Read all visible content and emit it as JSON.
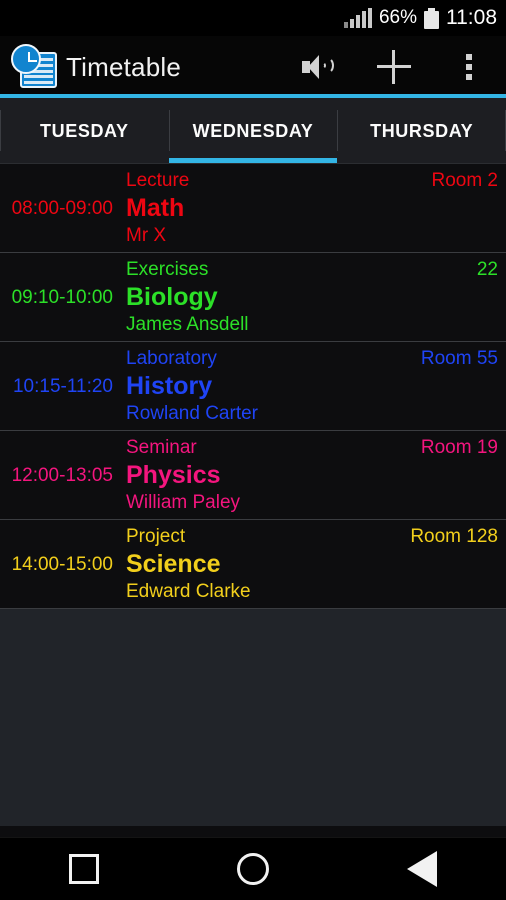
{
  "statusbar": {
    "signal_icon": "signal-bars-icon",
    "battery_percent": "66%",
    "battery_icon": "battery-icon",
    "time": "11:08"
  },
  "actionbar": {
    "app_icon": "timetable-app-icon",
    "title": "Timetable",
    "actions": [
      {
        "name": "volume-icon",
        "label": ""
      },
      {
        "name": "add-icon",
        "label": ""
      },
      {
        "name": "overflow-menu-icon",
        "label": ""
      }
    ],
    "accent_color": "#33b5e5"
  },
  "tabs": {
    "active_index": 1,
    "items": [
      {
        "label": "TUESDAY"
      },
      {
        "label": "WEDNESDAY"
      },
      {
        "label": "THURSDAY"
      }
    ]
  },
  "lessons": [
    {
      "time": "08:00-09:00",
      "type": "Lecture",
      "subject": "Math",
      "teacher": "Mr X",
      "room": "Room 2",
      "color": "#ee0612"
    },
    {
      "time": "09:10-10:00",
      "type": "Exercises",
      "subject": "Biology",
      "teacher": "James Ansdell",
      "room": "22",
      "color": "#2ce028"
    },
    {
      "time": "10:15-11:20",
      "type": "Laboratory",
      "subject": "History",
      "teacher": "Rowland Carter",
      "room": "Room 55",
      "color": "#1f44f5"
    },
    {
      "time": "12:00-13:05",
      "type": "Seminar",
      "subject": "Physics",
      "teacher": "William Paley",
      "room": "Room 19",
      "color": "#f4157e"
    },
    {
      "time": "14:00-15:00",
      "type": "Project",
      "subject": "Science",
      "teacher": "Edward Clarke",
      "room": "Room 128",
      "color": "#f2cf1c"
    }
  ],
  "navbar": {
    "recents": "recents-square-icon",
    "home": "home-circle-icon",
    "back": "back-triangle-icon"
  }
}
